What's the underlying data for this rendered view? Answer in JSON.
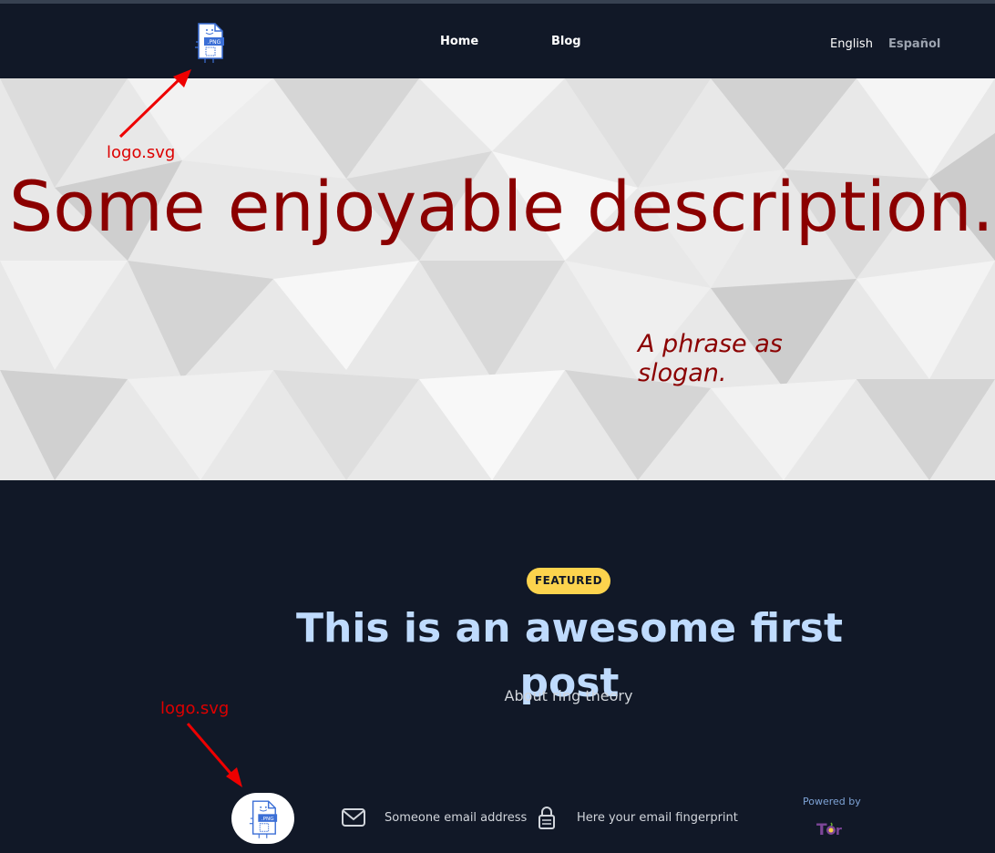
{
  "header": {
    "nav": [
      {
        "label": "Home"
      },
      {
        "label": "Blog"
      }
    ],
    "languages": [
      {
        "label": "English",
        "active": true
      },
      {
        "label": "Español",
        "active": false
      }
    ],
    "logo_icon": "png-file-icon"
  },
  "hero": {
    "title": "Some enjoyable description.",
    "slogan": "A phrase as slogan.",
    "annotation": "logo.svg"
  },
  "featured": {
    "badge": "FEATURED",
    "title": "This is an awesome first post",
    "subtitle": "About ring theory"
  },
  "footer": {
    "annotation": "logo.svg",
    "email": "Someone email address",
    "fingerprint": "Here your email fingerprint",
    "powered_by": "Powered by",
    "tor_logo_text": "Tor"
  },
  "colors": {
    "header_bg": "#111827",
    "hero_title": "#8b0000",
    "annotation_red": "#dd0000",
    "badge_bg": "#fcd34d",
    "post_title": "#bfdbfe"
  }
}
